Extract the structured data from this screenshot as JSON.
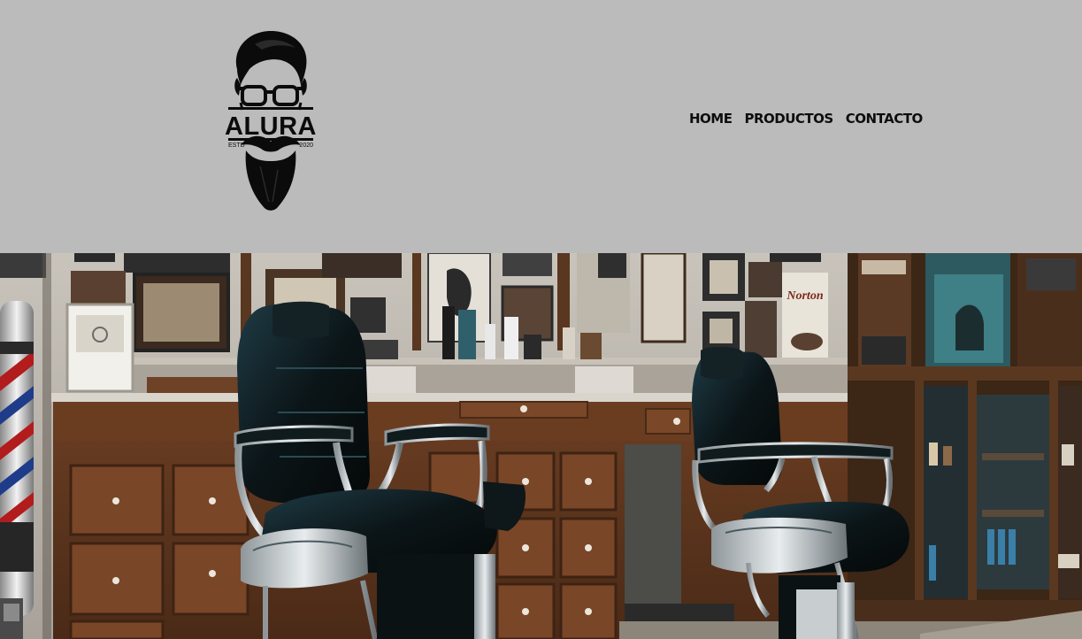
{
  "header": {
    "logo": {
      "brand": "ALURA",
      "left_text": "ESTD",
      "right_text": "2020",
      "icon": "bearded-man-logo"
    },
    "nav": {
      "items": [
        {
          "label": "HOME"
        },
        {
          "label": "PRODUCTOS"
        },
        {
          "label": "CONTACTO"
        }
      ]
    },
    "background_color": "#bbbbbb"
  },
  "hero": {
    "image": "barbershop-interior-photo",
    "poster_text": "Norton"
  }
}
